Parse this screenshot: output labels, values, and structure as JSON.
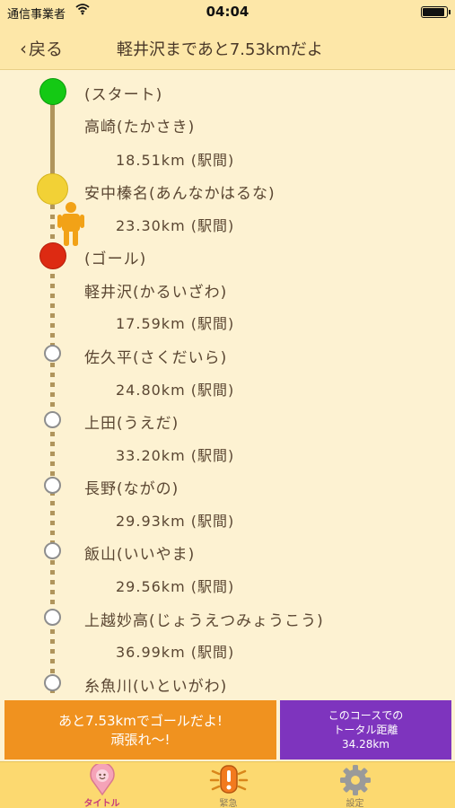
{
  "status_bar": {
    "carrier": "通信事業者",
    "time": "04:04"
  },
  "nav": {
    "back_label": "戻る",
    "title": "軽井沢まであと7.53kmだよ"
  },
  "route": {
    "items": [
      {
        "kind": "marker",
        "label": "(スタート)"
      },
      {
        "kind": "station",
        "label": "高崎(たかさき)"
      },
      {
        "kind": "distance",
        "label": "18.51km (駅間)"
      },
      {
        "kind": "station",
        "label": "安中榛名(あんなかはるな)"
      },
      {
        "kind": "distance",
        "label": "23.30km (駅間)"
      },
      {
        "kind": "marker",
        "label": "(ゴール)"
      },
      {
        "kind": "station",
        "label": "軽井沢(かるいざわ)"
      },
      {
        "kind": "distance",
        "label": "17.59km (駅間)"
      },
      {
        "kind": "station",
        "label": "佐久平(さくだいら)"
      },
      {
        "kind": "distance",
        "label": "24.80km (駅間)"
      },
      {
        "kind": "station",
        "label": "上田(うえだ)"
      },
      {
        "kind": "distance",
        "label": "33.20km (駅間)"
      },
      {
        "kind": "station",
        "label": "長野(ながの)"
      },
      {
        "kind": "distance",
        "label": "29.93km (駅間)"
      },
      {
        "kind": "station",
        "label": "飯山(いいやま)"
      },
      {
        "kind": "distance",
        "label": "29.56km (駅間)"
      },
      {
        "kind": "station",
        "label": "上越妙高(じょうえつみょうこう)"
      },
      {
        "kind": "distance",
        "label": "36.99km (駅間)"
      },
      {
        "kind": "station",
        "label": "糸魚川(いといがわ)"
      }
    ],
    "dot_colors": {
      "start": "#14c914",
      "current": "#f2d136",
      "goal": "#dd2a12",
      "upcoming": "#ffffff"
    },
    "current_icon": "walking-person-icon"
  },
  "cheer": {
    "line1": "あと7.53kmでゴールだよ!",
    "line2": "頑張れ〜!"
  },
  "total": {
    "line1": "このコースでの",
    "line2": "トータル距離",
    "value": "34.28km"
  },
  "tabs": [
    {
      "label": "タイトル",
      "icon": "map-pin-icon",
      "active": true
    },
    {
      "label": "緊急",
      "icon": "alert-icon",
      "active": false
    },
    {
      "label": "設定",
      "icon": "gear-icon",
      "active": false
    }
  ],
  "colors": {
    "accent_orange": "#f0921f",
    "accent_purple": "#7e34be",
    "tab_bar": "#fcd970",
    "header": "#fde7a8"
  }
}
